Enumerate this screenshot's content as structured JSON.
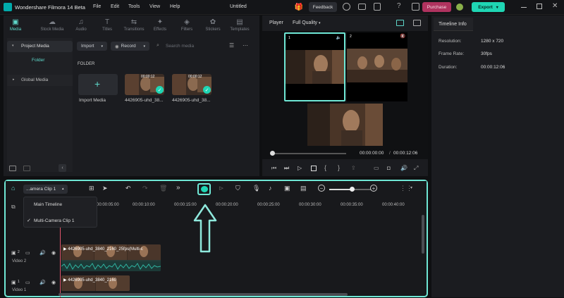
{
  "app": {
    "title": "Wondershare Filmora 14 Beta",
    "project": "Untitled",
    "menu": [
      "File",
      "Edit",
      "Tools",
      "View",
      "Help"
    ],
    "feedback": "Feedback",
    "purchase": "Purchase",
    "export": "Export"
  },
  "media_tabs": [
    {
      "label": "Media",
      "icon": "media-icon"
    },
    {
      "label": "Stock Media",
      "icon": "cloud-icon"
    },
    {
      "label": "Audio",
      "icon": "music-icon"
    },
    {
      "label": "Titles",
      "icon": "text-icon"
    },
    {
      "label": "Transitions",
      "icon": "transition-icon"
    },
    {
      "label": "Effects",
      "icon": "effects-icon"
    },
    {
      "label": "Filters",
      "icon": "filter-icon"
    },
    {
      "label": "Stickers",
      "icon": "sticker-icon"
    },
    {
      "label": "Templates",
      "icon": "template-icon"
    }
  ],
  "media_sidebar": {
    "project_media": "Project Media",
    "folder": "Folder",
    "global_media": "Global Media"
  },
  "media_toolbar": {
    "import": "Import",
    "record": "Record",
    "search_placeholder": "Search media"
  },
  "media": {
    "folder_label": "FOLDER",
    "import_media": "Import Media",
    "clips": [
      {
        "name": "4426905-uhd_38...",
        "duration": "00:00:12"
      },
      {
        "name": "4426905-uhd_38...",
        "duration": "00:00:12"
      }
    ]
  },
  "player": {
    "tab": "Player",
    "quality": "Full Quality",
    "angle1": "1",
    "angle2": "2",
    "current_time": "00:00:00:00",
    "total_time": "00:00:12:06",
    "progress": 0
  },
  "timeline_info": {
    "title": "Timeline Info",
    "rows": [
      {
        "label": "Resolution:",
        "value": "1280 x 720"
      },
      {
        "label": "Frame Rate:",
        "value": "30fps"
      },
      {
        "label": "Duration:",
        "value": "00:00:12:06"
      }
    ]
  },
  "timeline": {
    "clip_selector": "...amera Clip 1",
    "dropdown": {
      "items": [
        "Main Timeline",
        "Multi-Camera Clip 1"
      ],
      "checked": 1
    },
    "ruler": [
      "00:00:05:00",
      "00:00:10:00",
      "00:00:15:00",
      "00:00:20:00",
      "00:00:25:00",
      "00:00:30:00",
      "00:00:35:00",
      "00:00:40:00"
    ],
    "tracks": [
      {
        "num": "2",
        "label": "Video 2",
        "clip": "4426905-uhd_3840_2160_25fps(Multi-c"
      },
      {
        "num": "1",
        "label": "Video 1",
        "clip": "4426905-uhd_3840_2160"
      }
    ],
    "zoom_level": 0.55
  },
  "colors": {
    "accent": "#5fd8ca",
    "highlight": "#6fe7d5",
    "purchase": "#b0335f",
    "export": "#1fd6b4"
  }
}
